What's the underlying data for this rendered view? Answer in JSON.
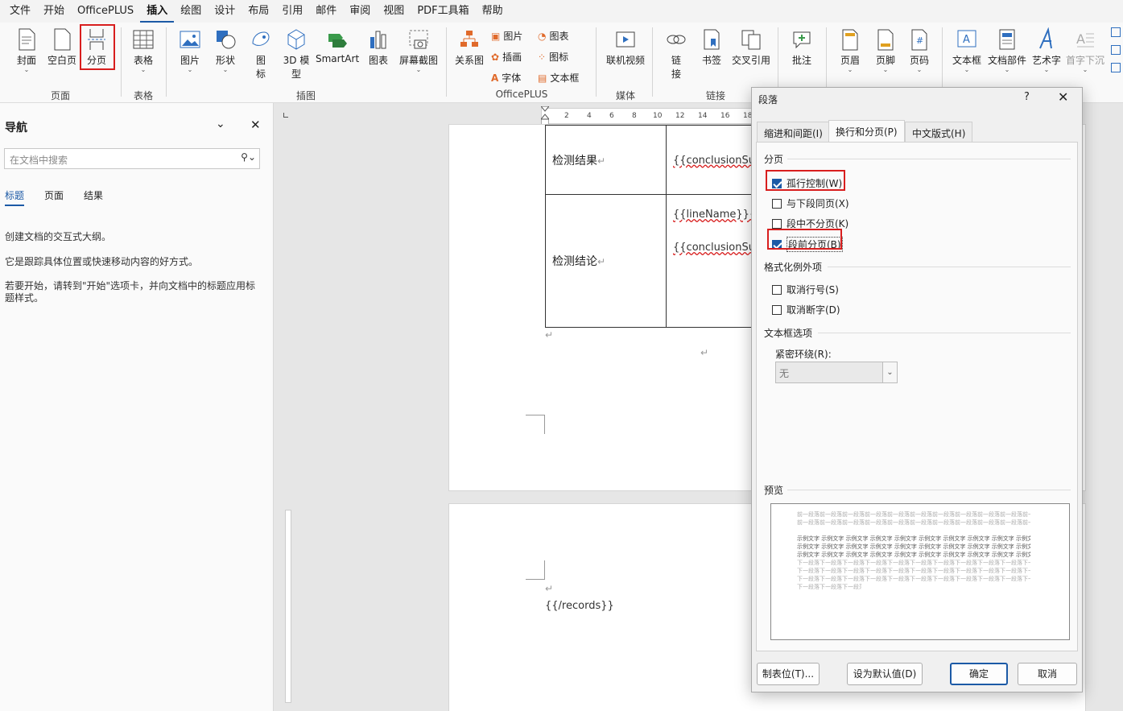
{
  "menu": {
    "items": [
      {
        "label": "文件",
        "active": false
      },
      {
        "label": "开始",
        "active": false
      },
      {
        "label": "OfficePLUS",
        "active": false
      },
      {
        "label": "插入",
        "active": true
      },
      {
        "label": "绘图",
        "active": false
      },
      {
        "label": "设计",
        "active": false
      },
      {
        "label": "布局",
        "active": false
      },
      {
        "label": "引用",
        "active": false
      },
      {
        "label": "邮件",
        "active": false
      },
      {
        "label": "审阅",
        "active": false
      },
      {
        "label": "视图",
        "active": false
      },
      {
        "label": "PDF工具箱",
        "active": false
      },
      {
        "label": "帮助",
        "active": false
      }
    ]
  },
  "ribbon": {
    "groups": {
      "page": "页面",
      "table": "表格",
      "illustrations": "插图",
      "officeplus": "OfficePLUS",
      "media": "媒体",
      "links": "链接"
    },
    "buttons": {
      "cover": "封面",
      "blank": "空白页",
      "page_break": "分页",
      "table": "表格",
      "picture": "图片",
      "shapes": "形状",
      "icons_1": "图",
      "icons_2": "标",
      "model3d_1": "3D 模",
      "model3d_2": "型",
      "smartart": "SmartArt",
      "chart": "图表",
      "screenshot": "屏幕截图",
      "relation": "关系图",
      "op_picture": "图片",
      "op_illustration": "插画",
      "op_font": "字体",
      "op_chart": "图表",
      "op_icon": "图标",
      "op_textbox": "文本框",
      "online_video": "联机视频",
      "link_1": "链",
      "link_2": "接",
      "bookmark": "书签",
      "cross_ref": "交叉引用",
      "comment": "批注",
      "header": "页眉",
      "footer": "页脚",
      "page_number": "页码",
      "textbox": "文本框",
      "doc_parts": "文档部件",
      "wordart": "艺术字",
      "dropcap": "首字下沉"
    }
  },
  "nav": {
    "title": "导航",
    "search_placeholder": "在文档中搜索",
    "tabs": [
      {
        "label": "标题",
        "active": true
      },
      {
        "label": "页面",
        "active": false
      },
      {
        "label": "结果",
        "active": false
      }
    ],
    "text1": "创建文档的交互式大纲。",
    "text2": "它是跟踪具体位置或快速移动内容的好方式。",
    "text3": "若要开始，请转到\"开始\"选项卡，并向文档中的标题应用标题样式。"
  },
  "ruler": {
    "ticks": [
      "2",
      "4",
      "6",
      "8",
      "10",
      "12",
      "14",
      "16",
      "18"
    ]
  },
  "document": {
    "row1_label": "检测结果",
    "row1_value": "{{conclusionSugg",
    "row2_label": "检测结论",
    "row2_value_a": "{{lineName}}{{tow",
    "row2_value_b": "{{conclusionSugg",
    "records_end": "{{/records}}"
  },
  "dialog": {
    "title": "段落",
    "help": "?",
    "tabs": [
      {
        "label": "缩进和间距(I)",
        "active": false
      },
      {
        "label": "换行和分页(P)",
        "active": true
      },
      {
        "label": "中文版式(H)",
        "active": false
      }
    ],
    "sections": {
      "pagination": "分页",
      "formatting_exceptions": "格式化例外项",
      "textbox_options": "文本框选项",
      "preview": "预览"
    },
    "checks": {
      "widow_control": {
        "label": "孤行控制(W)",
        "checked": true
      },
      "keep_with_next": {
        "label": "与下段同页(X)",
        "checked": false
      },
      "keep_lines_together": {
        "label": "段中不分页(K)",
        "checked": false
      },
      "page_break_before": {
        "label": "段前分页(B)",
        "checked": true
      },
      "suppress_line_numbers": {
        "label": "取消行号(S)",
        "checked": false
      },
      "dont_hyphenate": {
        "label": "取消断字(D)",
        "checked": false
      }
    },
    "tight_wrap_label": "紧密环绕(R):",
    "tight_wrap_value": "无",
    "preview_prev": "前一段落前一段落前一段落前一段落前一段落前一段落前一段落前一段落前一段落前一段落前一段落前一段落前一段落前一段落前一段落前一段落前一段落",
    "preview_sample": "示例文字 示例文字 示例文字 示例文字 示例文字 示例文字 示例文字 示例文字 示例文字 示例文字 示例文字 示例文字 示例文字 示例文字 示例文字 示例文字 示例文字 示例文字 示例文字 示例文字 示例文字 示例文字 示例文字 示例文字 示例文字 示例文字",
    "preview_next": "下一段落下一段落下一段落下一段落下一段落下一段落下一段落下一段落下一段落下一段落下一段落下一段落下一段落下一段落下一段落下一段落下一段落下一段落下一段落下一段落下一段落",
    "buttons": {
      "tabs": "制表位(T)...",
      "set_default": "设为默认值(D)",
      "ok": "确定",
      "cancel": "取消"
    }
  }
}
